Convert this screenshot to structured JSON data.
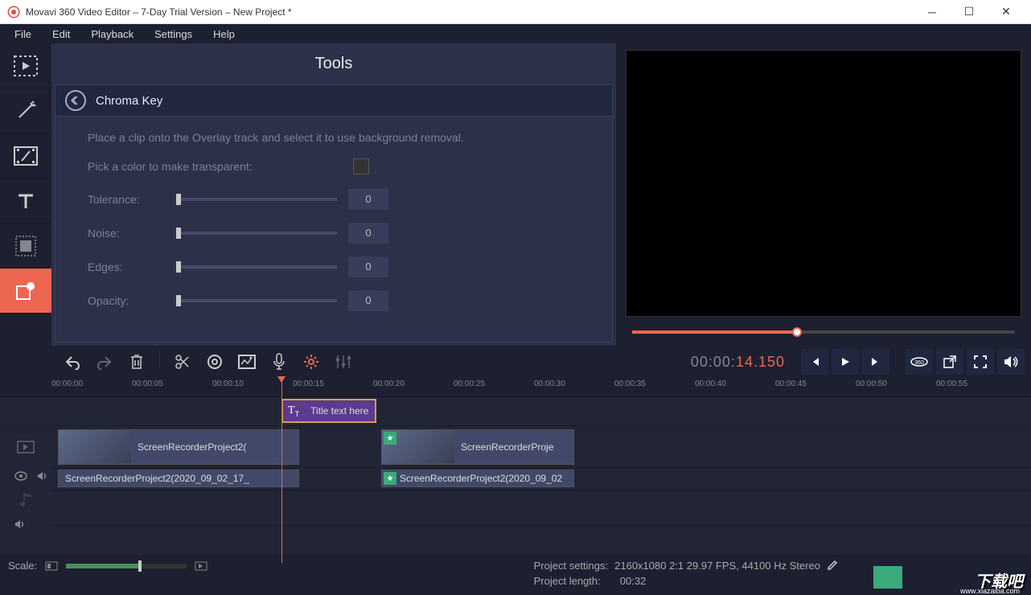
{
  "titlebar": "Movavi 360 Video Editor – 7-Day Trial Version – New Project *",
  "menu": {
    "file": "File",
    "edit": "Edit",
    "playback": "Playback",
    "settings": "Settings",
    "help": "Help"
  },
  "tools": {
    "title": "Tools",
    "panel_name": "Chroma Key",
    "hint": "Place a clip onto the Overlay track and select it to use background removal.",
    "pick_color": "Pick a color to make transparent:",
    "tolerance": {
      "label": "Tolerance:",
      "value": "0"
    },
    "noise": {
      "label": "Noise:",
      "value": "0"
    },
    "edges": {
      "label": "Edges:",
      "value": "0"
    },
    "opacity": {
      "label": "Opacity:",
      "value": "0"
    }
  },
  "timecode": {
    "gray": "00:00:",
    "orange": "14.150"
  },
  "ruler": [
    "00:00:00",
    "00:00:05",
    "00:00:10",
    "00:00:15",
    "00:00:20",
    "00:00:25",
    "00:00:30",
    "00:00:35",
    "00:00:40",
    "00:00:45",
    "00:00:50",
    "00:00:55"
  ],
  "clips": {
    "video1_label": "ScreenRecorderProject2(",
    "title_label": "Title text here",
    "video2_label": "ScreenRecorderProje",
    "audio1_label": "ScreenRecorderProject2(2020_09_02_17_",
    "audio2_label": "ScreenRecorderProject2(2020_09_02"
  },
  "status": {
    "scale": "Scale:",
    "settings_label": "Project settings:",
    "settings_val": "2160x1080 2:1 29.97 FPS, 44100 Hz Stereo",
    "length_label": "Project length:",
    "length_val": "00:32"
  },
  "watermark": {
    "main": "下载吧",
    "sub": "www.xiazaiba.com"
  }
}
